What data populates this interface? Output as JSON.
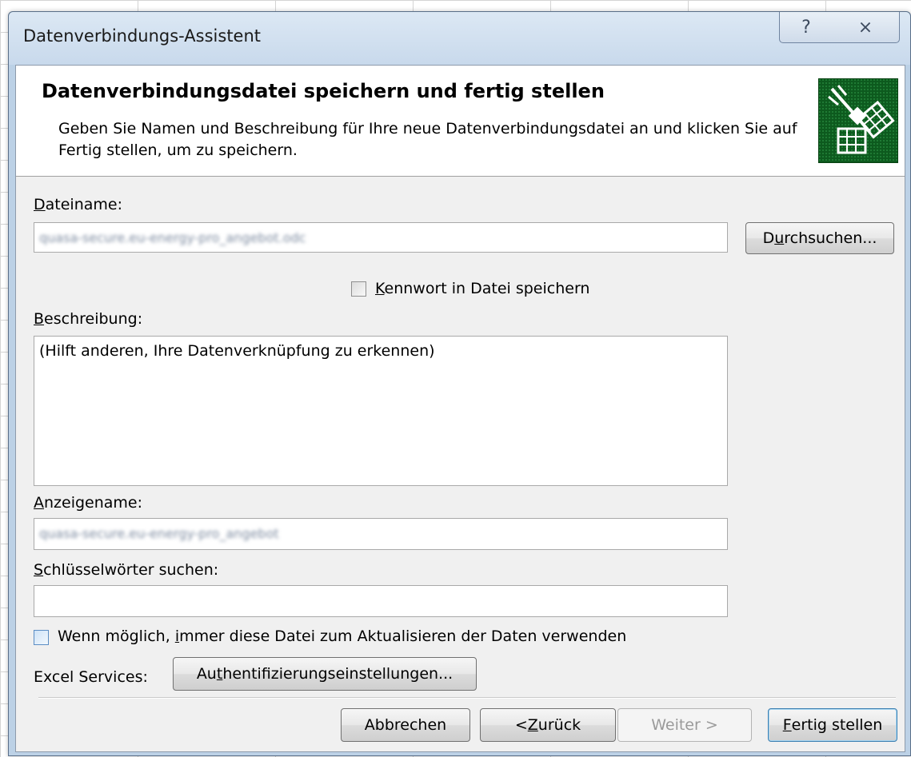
{
  "window": {
    "title": "Datenverbindungs-Assistent",
    "help_glyph": "?",
    "close_glyph": "⨯"
  },
  "header": {
    "title": "Datenverbindungsdatei speichern und fertig stellen",
    "description": "Geben Sie Namen und Beschreibung für Ihre neue Datenverbindungsdatei an und klicken Sie auf Fertig stellen, um zu speichern."
  },
  "form": {
    "filename": {
      "label_ul": "D",
      "label_rest": "ateiname:",
      "value": "quasa-secure.eu-energy-pro_angebot.odc"
    },
    "browse_button": {
      "pre": "D",
      "ul": "u",
      "post": "rchsuchen..."
    },
    "save_password": {
      "ul": "K",
      "rest": "ennwort in Datei speichern",
      "checked": false
    },
    "description": {
      "label_ul": "B",
      "label_rest": "eschreibung:",
      "value": "(Hilft anderen, Ihre Datenverknüpfung zu erkennen)"
    },
    "display_name": {
      "label_ul": "A",
      "label_rest": "nzeigename:",
      "value": "quasa-secure.eu-energy-pro_angebot"
    },
    "keywords": {
      "label_ul": "S",
      "label_rest": "chlüsselwörter suchen:",
      "value": ""
    },
    "always_use": {
      "pre": "Wenn möglich, ",
      "ul": "i",
      "post": "mmer diese Datei zum Aktualisieren der Daten verwenden",
      "checked": false
    },
    "excel_services_label": "Excel Services:",
    "auth_button": {
      "pre": "Au",
      "ul": "t",
      "post": "hentifizierungseinstellungen..."
    }
  },
  "footer": {
    "cancel": "Abbrechen",
    "back": {
      "pre": "< ",
      "ul": "Z",
      "post": "urück"
    },
    "next": "Weiter >",
    "finish": {
      "ul": "F",
      "post": "ertig stellen"
    }
  }
}
